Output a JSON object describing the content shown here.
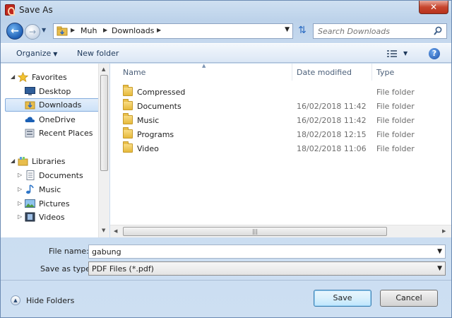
{
  "window": {
    "title": "Save As",
    "close_label": "✕"
  },
  "address": {
    "breadcrumbs": [
      "Muh",
      "Downloads"
    ],
    "search_placeholder": "Search Downloads"
  },
  "toolbar": {
    "organize_label": "Organize",
    "new_folder_label": "New folder",
    "help_label": "?"
  },
  "navigation": {
    "favorites_label": "Favorites",
    "favorites": [
      "Desktop",
      "Downloads",
      "OneDrive",
      "Recent Places"
    ],
    "selected": "Downloads",
    "libraries_label": "Libraries",
    "libraries": [
      "Documents",
      "Music",
      "Pictures",
      "Videos"
    ]
  },
  "filelist": {
    "columns": [
      "Name",
      "Date modified",
      "Type"
    ],
    "rows": [
      {
        "name": "Compressed",
        "date": "",
        "type": "File folder"
      },
      {
        "name": "Documents",
        "date": "16/02/2018 11:42",
        "type": "File folder"
      },
      {
        "name": "Music",
        "date": "16/02/2018 11:42",
        "type": "File folder"
      },
      {
        "name": "Programs",
        "date": "18/02/2018 12:15",
        "type": "File folder"
      },
      {
        "name": "Video",
        "date": "18/02/2018 11:06",
        "type": "File folder"
      }
    ]
  },
  "form": {
    "filename_label": "File name:",
    "filename_value": "gabung",
    "savetype_label": "Save as type:",
    "savetype_value": "PDF Files (*.pdf)"
  },
  "footer": {
    "hide_folders_label": "Hide Folders",
    "save_label": "Save",
    "cancel_label": "Cancel"
  },
  "colors": {
    "chrome": "#c6d9ee",
    "selection": "#cde2f8",
    "close": "#c7452e"
  }
}
